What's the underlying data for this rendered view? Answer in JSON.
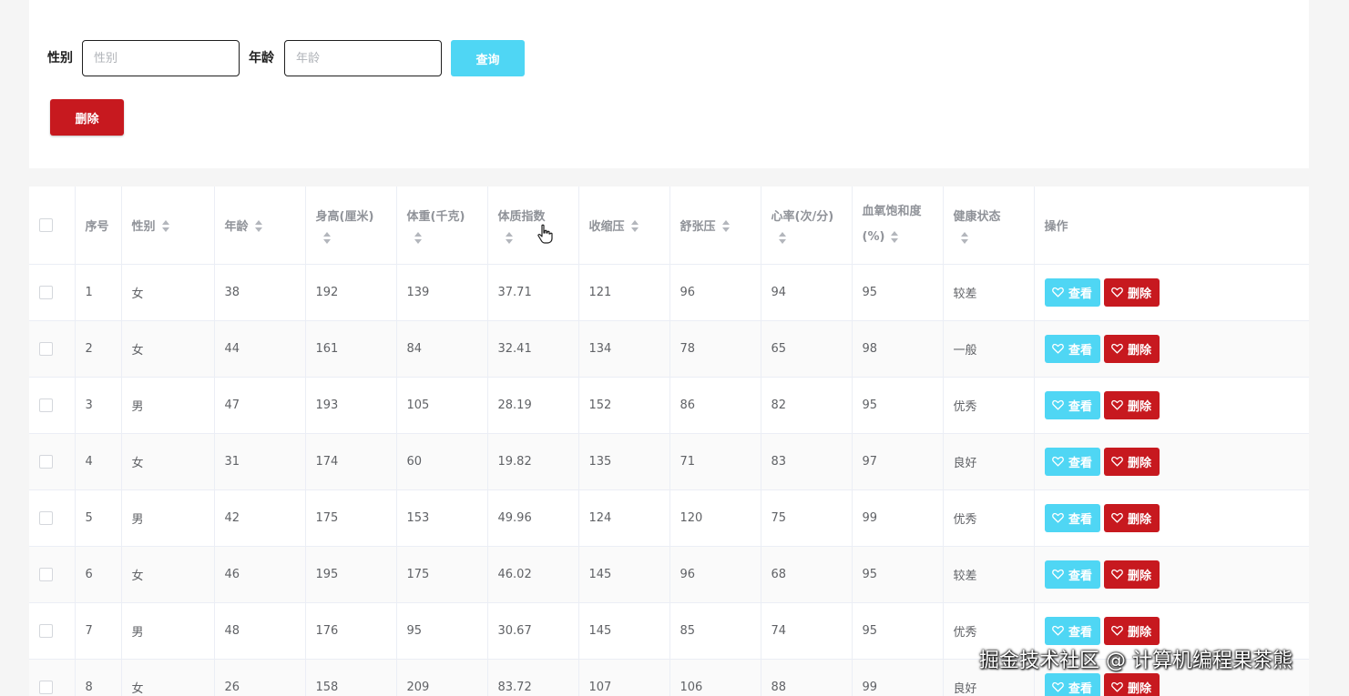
{
  "search": {
    "gender_label": "性别",
    "gender_placeholder": "性别",
    "age_label": "年龄",
    "age_placeholder": "年龄",
    "query_label": "查询"
  },
  "toolbar": {
    "delete_label": "删除"
  },
  "colors": {
    "primary_cyan": "#4fd6f4",
    "danger_red": "#c7191f"
  },
  "table": {
    "headers": {
      "index": "序号",
      "gender": "性别",
      "age": "年龄",
      "height": "身高(厘米)",
      "weight": "体重(千克)",
      "bmi": "体质指数",
      "systolic": "收缩压",
      "diastolic": "舒张压",
      "heart_rate_l1": "心率(次/分)",
      "spo2_l1": "血氧饱和度",
      "spo2_l2": "(%)",
      "health": "健康状态",
      "actions": "操作"
    },
    "view_label": "查看",
    "delete_label": "删除",
    "rows": [
      {
        "index": "1",
        "gender": "女",
        "age": "38",
        "height": "192",
        "weight": "139",
        "bmi": "37.71",
        "systolic": "121",
        "diastolic": "96",
        "heart_rate": "94",
        "spo2": "95",
        "health": "较差"
      },
      {
        "index": "2",
        "gender": "女",
        "age": "44",
        "height": "161",
        "weight": "84",
        "bmi": "32.41",
        "systolic": "134",
        "diastolic": "78",
        "heart_rate": "65",
        "spo2": "98",
        "health": "一般"
      },
      {
        "index": "3",
        "gender": "男",
        "age": "47",
        "height": "193",
        "weight": "105",
        "bmi": "28.19",
        "systolic": "152",
        "diastolic": "86",
        "heart_rate": "82",
        "spo2": "95",
        "health": "优秀"
      },
      {
        "index": "4",
        "gender": "女",
        "age": "31",
        "height": "174",
        "weight": "60",
        "bmi": "19.82",
        "systolic": "135",
        "diastolic": "71",
        "heart_rate": "83",
        "spo2": "97",
        "health": "良好"
      },
      {
        "index": "5",
        "gender": "男",
        "age": "42",
        "height": "175",
        "weight": "153",
        "bmi": "49.96",
        "systolic": "124",
        "diastolic": "120",
        "heart_rate": "75",
        "spo2": "99",
        "health": "优秀"
      },
      {
        "index": "6",
        "gender": "女",
        "age": "46",
        "height": "195",
        "weight": "175",
        "bmi": "46.02",
        "systolic": "145",
        "diastolic": "96",
        "heart_rate": "68",
        "spo2": "95",
        "health": "较差"
      },
      {
        "index": "7",
        "gender": "男",
        "age": "48",
        "height": "176",
        "weight": "95",
        "bmi": "30.67",
        "systolic": "145",
        "diastolic": "85",
        "heart_rate": "74",
        "spo2": "95",
        "health": "优秀"
      },
      {
        "index": "8",
        "gender": "女",
        "age": "26",
        "height": "158",
        "weight": "209",
        "bmi": "83.72",
        "systolic": "107",
        "diastolic": "106",
        "heart_rate": "88",
        "spo2": "99",
        "health": "良好"
      }
    ]
  },
  "watermark": "掘金技术社区 @ 计算机编程果茶熊"
}
